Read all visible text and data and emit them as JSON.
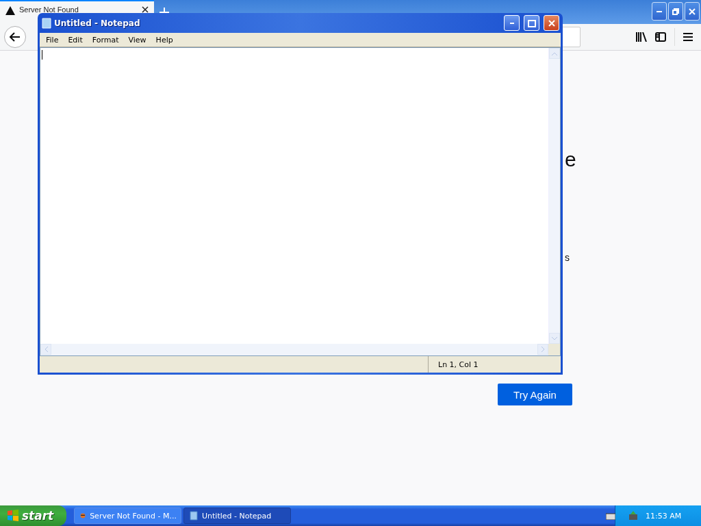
{
  "browser": {
    "tab": {
      "title": "Server Not Found"
    },
    "page": {
      "heading_fragment": "e",
      "text_fragment": "s",
      "button": "Try Again"
    }
  },
  "notepad": {
    "title": "Untitled - Notepad",
    "menu": [
      "File",
      "Edit",
      "Format",
      "View",
      "Help"
    ],
    "status": "Ln 1, Col 1"
  },
  "taskbar": {
    "start": "start",
    "tasks": [
      {
        "label": "Server Not Found - M...",
        "selected": false,
        "kind": "browser"
      },
      {
        "label": "Untitled - Notepad",
        "selected": true,
        "kind": "notepad"
      }
    ],
    "clock": "11:53 AM"
  }
}
